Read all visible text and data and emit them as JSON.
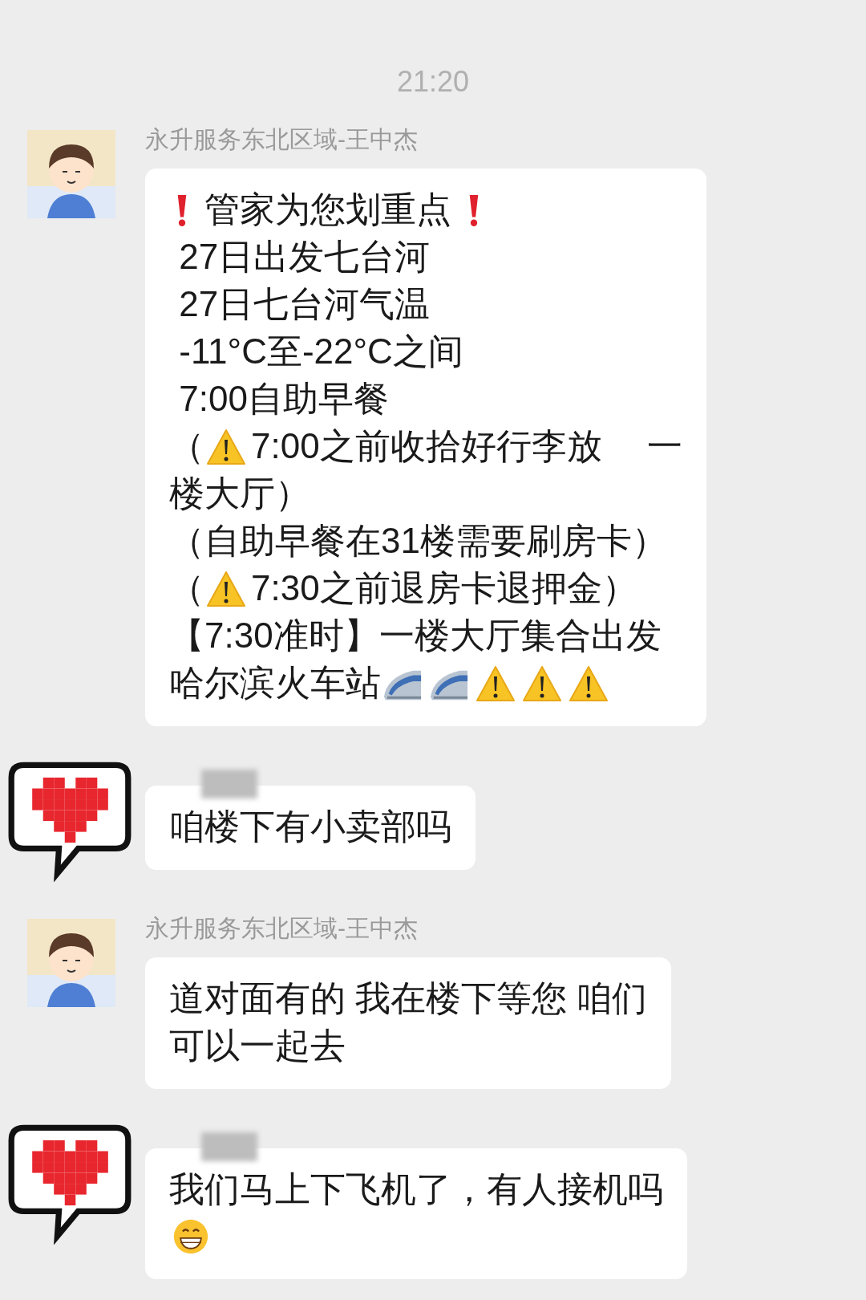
{
  "timestamp": "21:20",
  "messages": [
    {
      "avatar": {
        "kind": "cartoon"
      },
      "sender": "永升服务东北区域-王中杰",
      "sender_blurred": false,
      "lines": [
        [
          {
            "kind": "exclaim"
          },
          {
            "kind": "text",
            "text": " 管家为您划重点 "
          },
          {
            "kind": "exclaim"
          }
        ],
        [
          {
            "kind": "text",
            "text": " 27日出发七台河"
          }
        ],
        [
          {
            "kind": "text",
            "text": " 27日七台河气温"
          }
        ],
        [
          {
            "kind": "text",
            "text": " -11°C至-22°C之间"
          }
        ],
        [
          {
            "kind": "text",
            "text": " 7:00自助早餐"
          }
        ],
        [
          {
            "kind": "text",
            "text": "（"
          },
          {
            "kind": "warning"
          },
          {
            "kind": "text",
            "text": "7:00之前收拾好行李放　 一"
          }
        ],
        [
          {
            "kind": "text",
            "text": "楼大厅）"
          }
        ],
        [
          {
            "kind": "text",
            "text": "（自助早餐在31楼需要刷房卡）"
          }
        ],
        [
          {
            "kind": "text",
            "text": "（"
          },
          {
            "kind": "warning"
          },
          {
            "kind": "text",
            "text": "7:30之前退房卡退押金）"
          }
        ],
        [
          {
            "kind": "text",
            "text": "【7:30准时】一楼大厅集合出发"
          }
        ],
        [
          {
            "kind": "text",
            "text": "哈尔滨火车站"
          },
          {
            "kind": "train"
          },
          {
            "kind": "train"
          },
          {
            "kind": "warning"
          },
          {
            "kind": "warning"
          },
          {
            "kind": "warning"
          }
        ]
      ]
    },
    {
      "avatar": {
        "kind": "heart"
      },
      "sender_blurred": true,
      "lines": [
        [
          {
            "kind": "text",
            "text": "咱楼下有小卖部吗"
          }
        ]
      ]
    },
    {
      "avatar": {
        "kind": "cartoon"
      },
      "sender": "永升服务东北区域-王中杰",
      "sender_blurred": false,
      "lines": [
        [
          {
            "kind": "text",
            "text": "道对面有的 我在楼下等您 咱们"
          }
        ],
        [
          {
            "kind": "text",
            "text": "可以一起去"
          }
        ]
      ]
    },
    {
      "avatar": {
        "kind": "heart"
      },
      "sender_blurred": true,
      "lines": [
        [
          {
            "kind": "text",
            "text": "我们马上下飞机了，有人接机吗"
          }
        ],
        [
          {
            "kind": "grin"
          }
        ]
      ]
    }
  ]
}
